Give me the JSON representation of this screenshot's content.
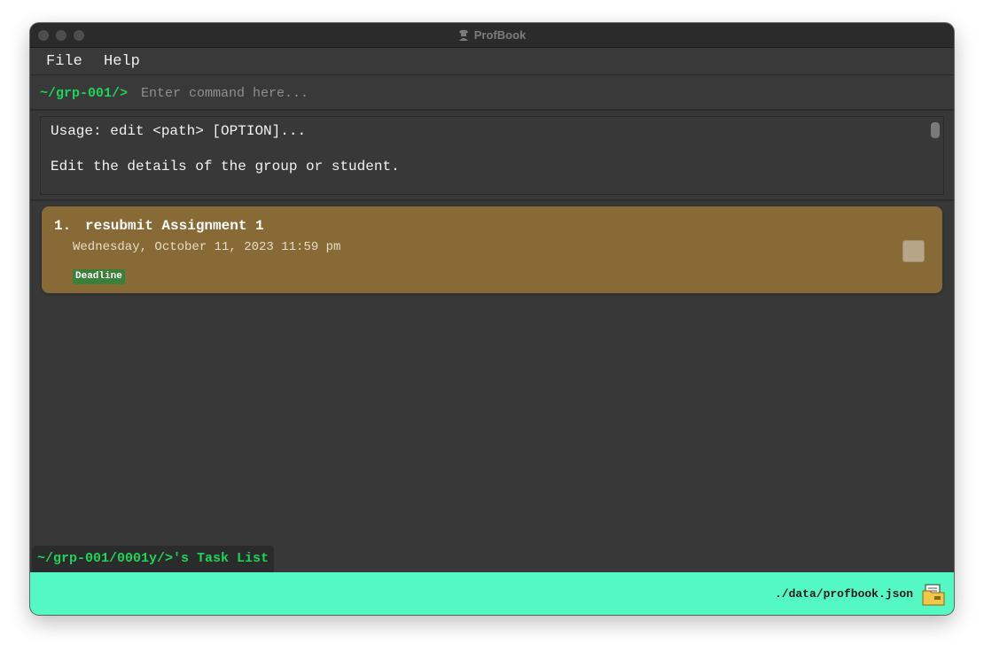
{
  "window": {
    "title": "ProfBook"
  },
  "menu": {
    "file_label": "File",
    "help_label": "Help"
  },
  "command": {
    "prompt": "~/grp-001/>",
    "placeholder": "Enter command here...",
    "value": ""
  },
  "result": {
    "line1": "Usage: edit <path> [OPTION]...",
    "line2": "Edit the details of the group or student."
  },
  "tasks": [
    {
      "index": "1.",
      "title": "resubmit Assignment 1",
      "datetime": "Wednesday, October 11, 2023 11:59 pm",
      "tag": "Deadline",
      "done": false
    }
  ],
  "list_label": "~/grp-001/0001y/>'s Task List",
  "status": {
    "save_path": "./data/profbook.json"
  },
  "colors": {
    "accent_green": "#1dd45b",
    "card_brown": "#886a37",
    "status_bar": "#54f8c2",
    "tag_green": "#3a7f3a"
  },
  "icons": {
    "app": "profbook-logo-icon",
    "status": "folder-icon"
  }
}
